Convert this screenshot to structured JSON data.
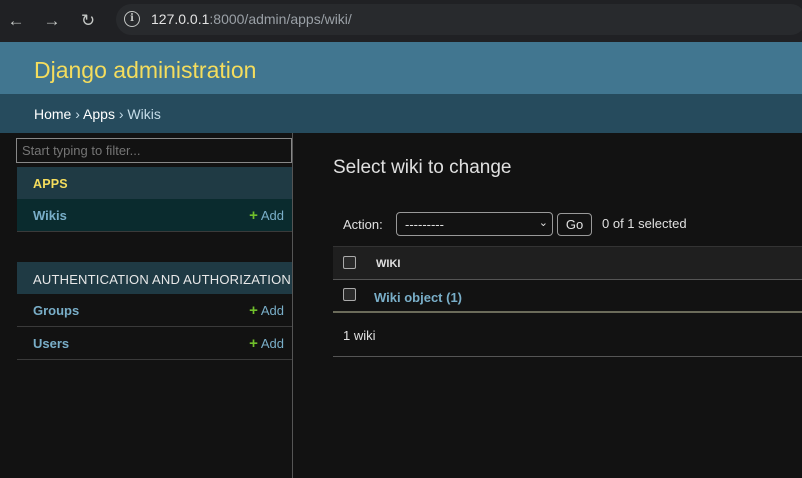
{
  "browser": {
    "url_host": "127.0.0.1",
    "url_rest": ":8000/admin/apps/wiki/"
  },
  "header": {
    "site_title": "Django administration"
  },
  "breadcrumbs": {
    "home": "Home",
    "sep1": " › ",
    "apps": "Apps",
    "sep2": " › ",
    "current": "Wikis"
  },
  "sidebar": {
    "filter_placeholder": "Start typing to filter...",
    "sections": [
      {
        "caption": "APPS",
        "models": [
          {
            "name": "Wikis",
            "add_label": "Add"
          }
        ]
      },
      {
        "caption": "AUTHENTICATION AND AUTHORIZATION",
        "models": [
          {
            "name": "Groups",
            "add_label": "Add"
          },
          {
            "name": "Users",
            "add_label": "Add"
          }
        ]
      }
    ]
  },
  "main": {
    "title": "Select wiki to change",
    "actions": {
      "label": "Action:",
      "selected_option": "---------",
      "go_label": "Go",
      "selected_count": "0 of 1 selected"
    },
    "table": {
      "column_header": "WIKI",
      "rows": [
        {
          "label": "Wiki object (1)"
        }
      ]
    },
    "paginator": "1 wiki"
  },
  "colors": {
    "header_bg": "#417690",
    "breadcrumbs_bg": "#264b5d",
    "site_title": "#f5dd5d",
    "link": "#79aec8",
    "add_plus": "#70bf2b"
  }
}
